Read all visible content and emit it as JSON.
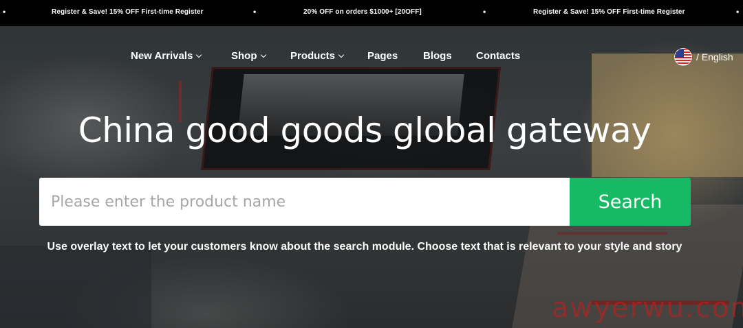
{
  "announcement": {
    "items": [
      "Register & Save! 15% OFF First-time Register",
      "20% OFF on orders $1000+  [20OFF]",
      "Register & Save! 15% OFF First-time Register"
    ],
    "separator": "•"
  },
  "nav": {
    "items": [
      {
        "label": "New Arrivals",
        "dropdown": true
      },
      {
        "label": "Shop",
        "dropdown": true
      },
      {
        "label": "Products",
        "dropdown": true
      },
      {
        "label": "Pages",
        "dropdown": false
      },
      {
        "label": "Blogs",
        "dropdown": false
      },
      {
        "label": "Contacts",
        "dropdown": false
      }
    ]
  },
  "language": {
    "label": "/ English",
    "flag_icon": "us-flag-icon"
  },
  "hero": {
    "headline": "China good goods global gateway",
    "search": {
      "placeholder": "Please enter the product name",
      "value": "",
      "button_label": "Search"
    },
    "overlay_text": "Use overlay text to let your customers know about the search module. Choose text that is relevant to your style and story"
  },
  "watermark": "awyerwu.com",
  "colors": {
    "announcement_bg": "#000000",
    "search_button": "#16b964",
    "watermark": "#c81e1e"
  }
}
